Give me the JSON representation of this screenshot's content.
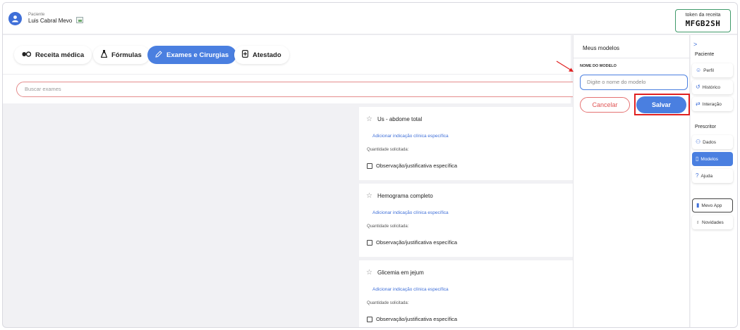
{
  "header": {
    "patient_label": "Paciente",
    "patient_name": "Luis Cabral Mevo",
    "token_label": "token da receita",
    "token_value": "MFGB2SH"
  },
  "tabs": [
    {
      "label": "Receita médica",
      "icon": "pills-icon",
      "active": false
    },
    {
      "label": "Fórmulas",
      "icon": "flask-icon",
      "active": false
    },
    {
      "label": "Exames e Cirurgias",
      "icon": "pencil-icon",
      "active": true
    },
    {
      "label": "Atestado",
      "icon": "document-plus-icon",
      "active": false
    }
  ],
  "search": {
    "placeholder": "Buscar exames"
  },
  "exams": [
    {
      "title": "Us - abdome total",
      "link": "Adicionar indicação clínica específica",
      "qty_label": "Quantidade solicitada:",
      "obs_label": "Observação/justificativa específica"
    },
    {
      "title": "Hemograma completo",
      "link": "Adicionar indicação clínica específica",
      "qty_label": "Quantidade solicitada:",
      "obs_label": "Observação/justificativa específica"
    },
    {
      "title": "Glicemia em jejum",
      "link": "Adicionar indicação clínica específica",
      "qty_label": "Quantidade solicitada:",
      "obs_label": "Observação/justificativa específica"
    }
  ],
  "modelos_panel": {
    "title": "Meus modelos",
    "name_label": "NOME DO MODELO",
    "name_placeholder": "Digite o nome do modelo",
    "cancel_label": "Cancelar",
    "save_label": "Salvar"
  },
  "right_sidebar": {
    "collapse_icon": ">",
    "paciente_label": "Paciente",
    "paciente_items": [
      {
        "label": "Perfil",
        "icon": "person-icon"
      },
      {
        "label": "Histórico",
        "icon": "history-icon"
      },
      {
        "label": "Interação",
        "icon": "swap-icon"
      }
    ],
    "prescritor_label": "Prescritor",
    "prescritor_items": [
      {
        "label": "Dados",
        "icon": "users-icon",
        "active": false
      },
      {
        "label": "Modelos",
        "icon": "file-icon",
        "active": true
      },
      {
        "label": "Ajuda",
        "icon": "help-icon",
        "active": false
      }
    ],
    "extra_items": [
      {
        "label": "Mevo App",
        "icon": "phone-icon"
      },
      {
        "label": "Novidades",
        "icon": "lightbulb-icon"
      }
    ]
  },
  "colors": {
    "accent": "#4a7fe0",
    "danger": "#e05555",
    "token_border": "#3f9a6a"
  }
}
